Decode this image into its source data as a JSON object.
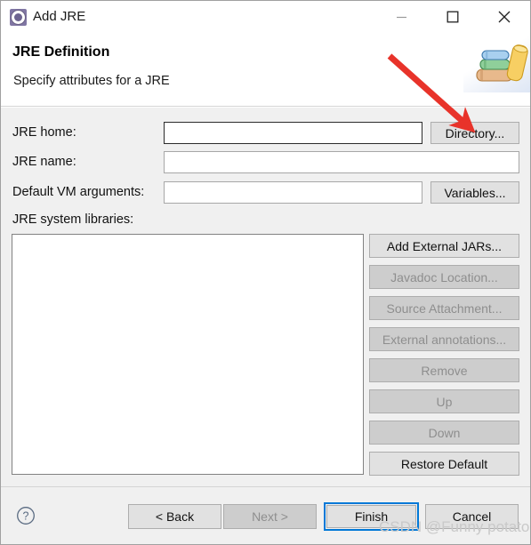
{
  "window": {
    "title": "Add JRE",
    "icon": "jre-gear-icon",
    "controls": {
      "minimize": "minimize-icon",
      "maximize": "maximize-icon",
      "close": "close-icon"
    }
  },
  "header": {
    "title": "JRE Definition",
    "subtitle": "Specify attributes for a JRE",
    "banner_icon": "books-stack-icon"
  },
  "form": {
    "jre_home": {
      "label": "JRE home:",
      "value": "",
      "placeholder": "",
      "focused": true
    },
    "jre_name": {
      "label": "JRE name:",
      "value": "",
      "placeholder": ""
    },
    "default_vm_args": {
      "label": "Default VM arguments:",
      "value": "",
      "placeholder": ""
    },
    "system_libraries": {
      "label": "JRE system libraries:",
      "items": []
    },
    "directory_button": {
      "label": "Directory...",
      "enabled": true
    },
    "variables_button": {
      "label": "Variables...",
      "enabled": true
    }
  },
  "side_buttons": [
    {
      "label": "Add External JARs...",
      "enabled": true
    },
    {
      "label": "Javadoc Location...",
      "enabled": false
    },
    {
      "label": "Source Attachment...",
      "enabled": false
    },
    {
      "label": "External annotations...",
      "enabled": false
    },
    {
      "label": "Remove",
      "enabled": false
    },
    {
      "label": "Up",
      "enabled": false
    },
    {
      "label": "Down",
      "enabled": false
    },
    {
      "label": "Restore Default",
      "enabled": true
    }
  ],
  "footer": {
    "help": "help-icon",
    "back": {
      "label": "< Back",
      "enabled": true
    },
    "next": {
      "label": "Next >",
      "enabled": false
    },
    "finish": {
      "label": "Finish",
      "enabled": true,
      "focused": true
    },
    "cancel": {
      "label": "Cancel",
      "enabled": true
    }
  },
  "annotation": {
    "arrow_color": "#e8332a",
    "points_to": "Directory..."
  },
  "watermark": "CSDN @Funny potato",
  "colors": {
    "dialog_bg": "#f0f0f0",
    "header_bg": "#ffffff",
    "button_bg": "#cdcdcd",
    "focus_blue": "#0078d7",
    "disabled_text": "#8e8e8e",
    "title_icon_purple": "#8076a3",
    "arrow_red": "#e8332a"
  }
}
